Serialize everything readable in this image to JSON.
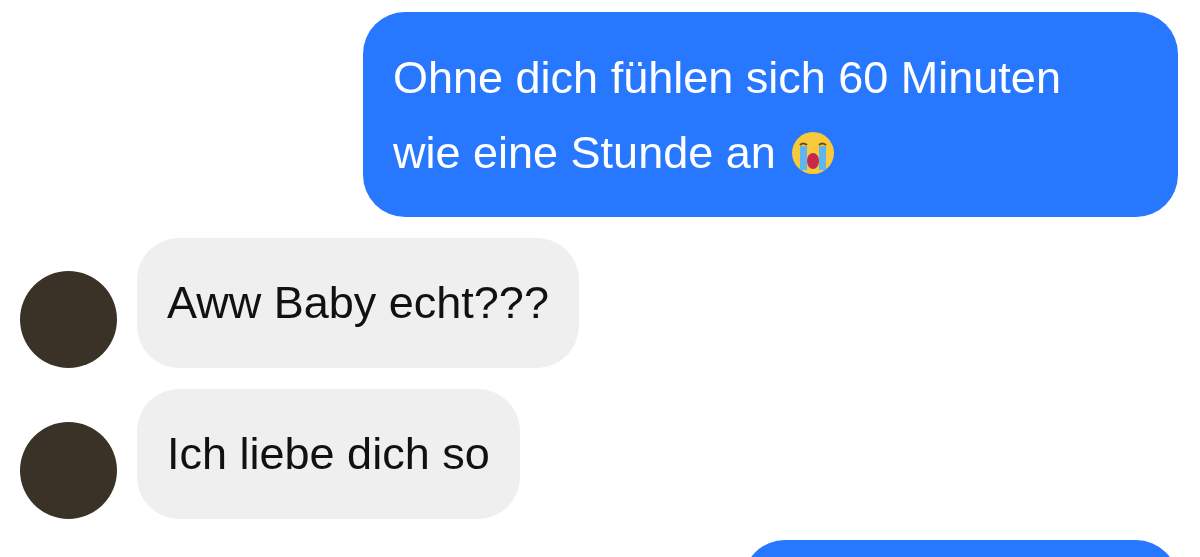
{
  "messages": [
    {
      "kind": "outgoing",
      "text": "Ohne dich fühlen sich 60 Minuten wie eine Stunde an",
      "emoji_after": true
    },
    {
      "kind": "incoming",
      "text": "Aww Baby echt???",
      "avatar": true
    },
    {
      "kind": "incoming",
      "text": "Ich liebe dich so",
      "avatar": true
    },
    {
      "kind": "outgoing_cut"
    }
  ]
}
